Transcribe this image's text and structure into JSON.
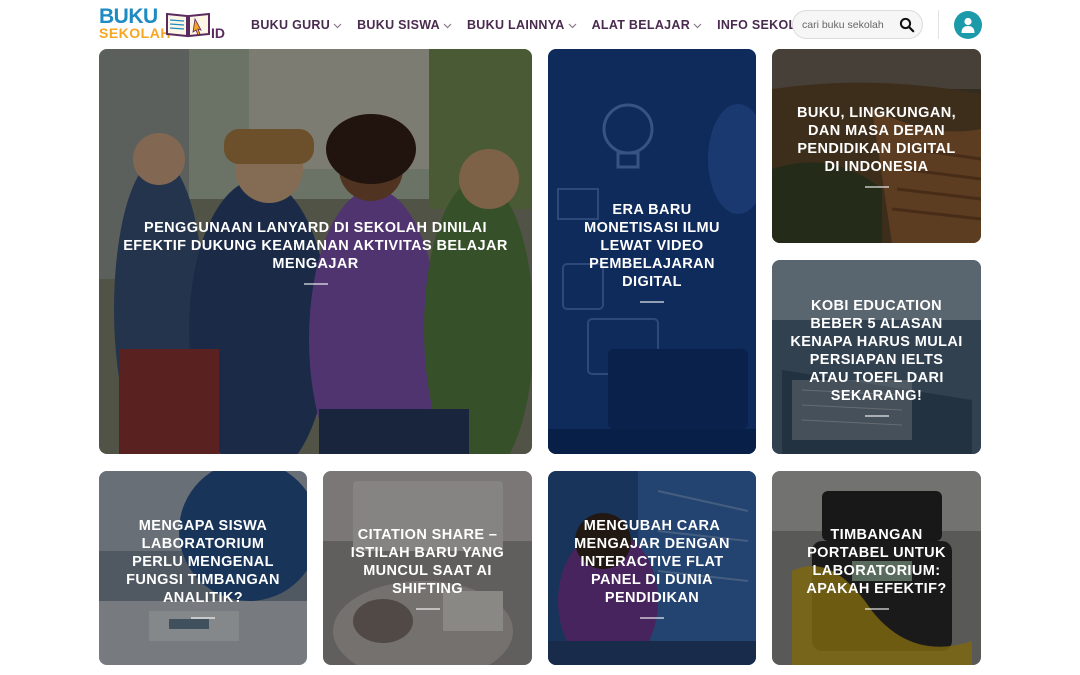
{
  "logo": {
    "line1": "BUKU",
    "line2": "SEKOLAH",
    "suffix": "ID"
  },
  "nav": {
    "items": [
      {
        "label": "BUKU GURU",
        "has_dropdown": true
      },
      {
        "label": "BUKU SISWA",
        "has_dropdown": true
      },
      {
        "label": "BUKU LAINNYA",
        "has_dropdown": true
      },
      {
        "label": "ALAT BELAJAR",
        "has_dropdown": true
      },
      {
        "label": "INFO SEKOLAH",
        "has_dropdown": false
      }
    ]
  },
  "search": {
    "placeholder": "cari buku sekolah",
    "value": ""
  },
  "colors": {
    "brand_blue": "#1e8bc3",
    "brand_orange": "#f5a623",
    "nav_text": "#4a2a4f",
    "avatar": "#1b9aaa"
  },
  "icons": {
    "search": "search-icon",
    "user": "user-icon",
    "chevron": "chevron-down-icon"
  },
  "cards": [
    {
      "title": "PENGGUNAAN LANYARD DI SEKOLAH DINILAI EFEKTIF DUKUNG KEAMANAN AKTIVITAS BELAJAR MENGAJAR"
    },
    {
      "title": "ERA BARU MONETISASI ILMU LEWAT VIDEO PEMBELAJARAN DIGITAL"
    },
    {
      "title": "BUKU, LINGKUNGAN, DAN MASA DEPAN PENDIDIKAN DIGITAL DI INDONESIA"
    },
    {
      "title": "KOBI EDUCATION BEBER 5 ALASAN KENAPA HARUS MULAI PERSIAPAN IELTS ATAU TOEFL DARI SEKARANG!"
    },
    {
      "title": "MENGAPA SISWA LABORATORIUM PERLU MENGENAL FUNGSI TIMBANGAN ANALITIK?"
    },
    {
      "title": "CITATION SHARE – ISTILAH BARU YANG MUNCUL SAAT AI SHIFTING"
    },
    {
      "title": "MENGUBAH CARA MENGAJAR DENGAN INTERACTIVE FLAT PANEL DI DUNIA PENDIDIKAN"
    },
    {
      "title": "TIMBANGAN PORTABEL UNTUK LABORATORIUM: APAKAH EFEKTIF?"
    }
  ]
}
